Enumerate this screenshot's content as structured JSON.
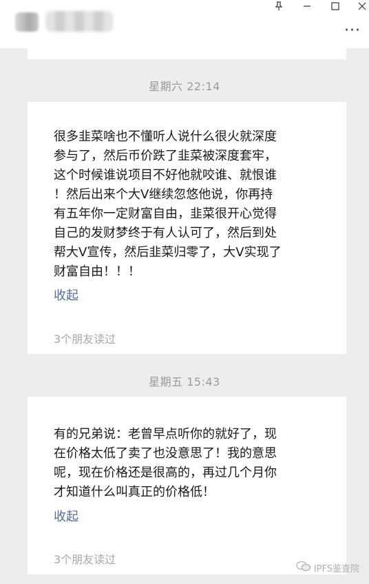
{
  "window": {
    "controls": [
      "pin-icon",
      "minimize-icon",
      "maximize-icon",
      "close-icon"
    ],
    "more_icon": "more-dots-icon"
  },
  "messages": [
    {
      "timestamp": "星期六  22:14",
      "text": "很多韭菜啥也不懂听人说什么很火就深度\n参与了，然后币价跌了韭菜被深度套牢，\n这个时候谁说项目不好他就咬谁、就恨谁\n！然后出来个大V继续忽悠他说，你再持\n有五年你一定财富自由，韭菜很开心觉得\n自己的发财梦终于有人认可了，然后到处\n帮大V宣传，然后韭菜归零了，大V实现了\n财富自由！！！",
      "collapse_label": "收起",
      "read_status": "3个朋友读过"
    },
    {
      "timestamp": "星期五  15:43",
      "text": "有的兄弟说：老曾早点听你的就好了，现\n在价格太低了卖了也没意思了！我的意思\n呢，现在价格还是很高的，再过几个月你\n才知道什么叫真正的价格低！",
      "collapse_label": "收起",
      "read_status": "3个朋友读过"
    }
  ],
  "watermark": {
    "text": "IPFS鉴查院",
    "icon": "wechat-icon"
  },
  "colors": {
    "background": "#ededed",
    "card": "#ffffff",
    "link": "#576b95",
    "muted": "#a8a8a8"
  }
}
